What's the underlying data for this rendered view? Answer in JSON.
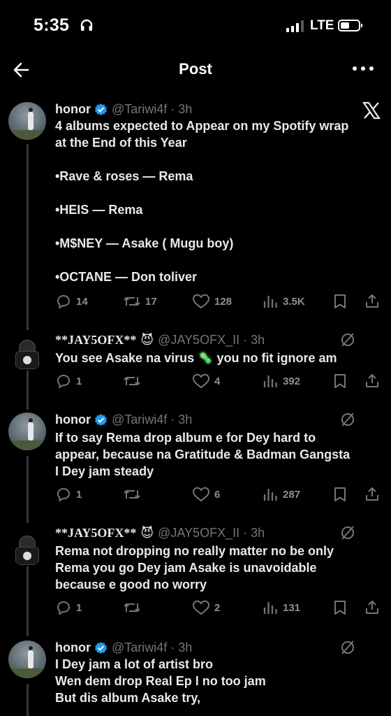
{
  "status_bar": {
    "time": "5:35",
    "network": "LTE"
  },
  "nav": {
    "title": "Post"
  },
  "tweets": [
    {
      "name": "honor",
      "handle": "@Tariwi4f · 3h",
      "lines": [
        "4 albums expected to Appear on my Spotify wrap",
        "at the End of this Year",
        "",
        "•Rave & roses — Rema",
        "",
        "•HEIS — Rema",
        "",
        "•M$NEY — Asake ( Mugu boy)",
        "",
        "•OCTANE — Don toliver"
      ],
      "replies": "14",
      "reposts": "17",
      "likes": "128",
      "views": "3.5K"
    },
    {
      "name": "**JAY5OFX**",
      "handle": "@JAY5OFX_II · 3h",
      "lines": [
        "You see Asake na virus 🦠 you no fit ignore am"
      ],
      "replies": "1",
      "reposts": "",
      "likes": "4",
      "views": "392"
    },
    {
      "name": "honor",
      "handle": "@Tariwi4f · 3h",
      "lines": [
        "If to say Rema drop album e for Dey hard to",
        "appear, because na Gratitude & Badman Gangsta",
        "I Dey jam steady"
      ],
      "replies": "1",
      "reposts": "",
      "likes": "6",
      "views": "287"
    },
    {
      "name": "**JAY5OFX**",
      "handle": "@JAY5OFX_II · 3h",
      "lines": [
        "Rema not dropping no really matter no be only",
        "Rema you go Dey jam Asake is unavoidable",
        "because e good no worry"
      ],
      "replies": "1",
      "reposts": "",
      "likes": "2",
      "views": "131"
    },
    {
      "name": "honor",
      "handle": "@Tariwi4f · 3h",
      "lines": [
        "I Dey jam a lot of artist bro",
        "Wen dem drop Real Ep I no too jam",
        "But dis album Asake try,"
      ]
    }
  ],
  "colors": {
    "background": "#000000",
    "text": "#e7e9ea",
    "muted": "#71767b",
    "verified": "#1d9bf0"
  }
}
